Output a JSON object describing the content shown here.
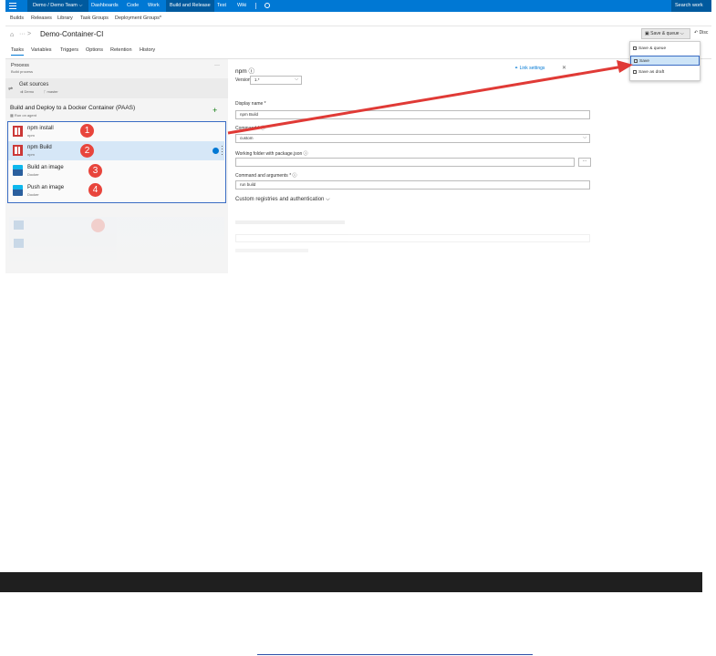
{
  "topbar": {
    "project": "Demo / Demo Team",
    "nav": [
      "Dashboards",
      "Code",
      "Work",
      "Build and Release",
      "Test",
      "Wiki"
    ],
    "search": "Search work"
  },
  "subnav": [
    "Builds",
    "Releases",
    "Library",
    "Task Groups",
    "Deployment Groups*"
  ],
  "titlebar": {
    "title": "Demo-Container-CI",
    "ellipsis": "···",
    "chev": ">"
  },
  "toolbar": {
    "save_queue": "Save & queue",
    "discard": "Disc"
  },
  "save_menu": [
    "Save & queue",
    "Save",
    "Save as draft"
  ],
  "tabs": [
    "Tasks",
    "Variables",
    "Triggers",
    "Options",
    "Retention",
    "History"
  ],
  "process": {
    "title": "Process",
    "subtitle": "Build process",
    "more": "···"
  },
  "get_sources": {
    "title": "Get sources",
    "repo": "Demo",
    "branch": "master"
  },
  "phase": {
    "title": "Build and Deploy to a Docker Container (PAAS)",
    "subtitle": "Run on agent",
    "add": "+"
  },
  "tasks": [
    {
      "name": "npm install",
      "sub": "npm",
      "icon": "npm-icon",
      "badge": "1"
    },
    {
      "name": "npm Build",
      "sub": "npm",
      "icon": "npm-icon",
      "badge": "2"
    },
    {
      "name": "Build an image",
      "sub": "Docker",
      "icon": "docker-icon",
      "badge": "3"
    },
    {
      "name": "Push an image",
      "sub": "Docker",
      "icon": "docker-icon",
      "badge": "4"
    }
  ],
  "detail": {
    "title": "npm",
    "link_settings": "Link settings",
    "close": "✕",
    "version_label": "Version",
    "version_value": "1.*",
    "display_name_label": "Display name *",
    "display_name_value": "npm Build",
    "command_label": "Command *",
    "command_value": "custom",
    "working_folder_label": "Working folder with package.json",
    "browse": "···",
    "cmd_args_label": "Command and arguments *",
    "cmd_args_value": "run build",
    "custom_registries": "Custom registries and authentication"
  },
  "colors": {
    "accent": "#0078d4",
    "badge": "#e8453c",
    "arrow": "#e03a36",
    "highlight_border": "#3a6cc4"
  }
}
